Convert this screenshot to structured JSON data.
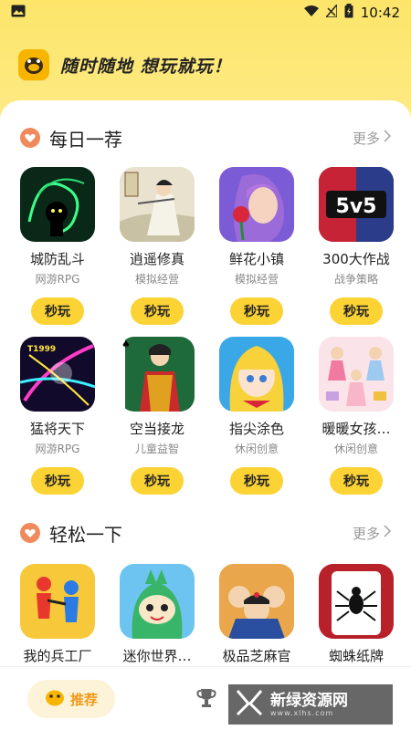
{
  "status_bar": {
    "time": "10:42"
  },
  "banner": {
    "slogan": "随时随地 想玩就玩！"
  },
  "sections": [
    {
      "title": "每日一荐",
      "more_label": "更多",
      "games": [
        {
          "name": "城防乱斗",
          "category": "网游RPG",
          "play_label": "秒玩",
          "icon": "dragon-warrior-icon"
        },
        {
          "name": "逍遥修真",
          "category": "模拟经营",
          "play_label": "秒玩",
          "icon": "cultivator-icon"
        },
        {
          "name": "鲜花小镇",
          "category": "模拟经营",
          "play_label": "秒玩",
          "icon": "flower-girl-icon"
        },
        {
          "name": "300大作战",
          "category": "战争策略",
          "play_label": "秒玩",
          "icon": "5v5-icon"
        },
        {
          "name": "猛将天下",
          "category": "网游RPG",
          "play_label": "秒玩",
          "icon": "neon-general-icon"
        },
        {
          "name": "空当接龙",
          "category": "儿童益智",
          "play_label": "秒玩",
          "icon": "playing-card-icon"
        },
        {
          "name": "指尖涂色",
          "category": "休闲创意",
          "play_label": "秒玩",
          "icon": "anime-girl-icon"
        },
        {
          "name": "暖暖女孩…",
          "category": "休闲创意",
          "play_label": "秒玩",
          "icon": "dress-up-icon"
        }
      ]
    },
    {
      "title": "轻松一下",
      "more_label": "更多",
      "games": [
        {
          "name": "我的兵工厂",
          "icon": "stickman-army-icon"
        },
        {
          "name": "迷你世界…",
          "icon": "green-monster-icon"
        },
        {
          "name": "极品芝麻官",
          "icon": "officials-icon"
        },
        {
          "name": "蜘蛛纸牌",
          "icon": "spider-card-icon"
        }
      ]
    }
  ],
  "tabbar": {
    "recommend_label": "推荐"
  },
  "watermark": {
    "text": "新绿资源网",
    "sub": "www.xlhs.com"
  },
  "colors": {
    "accent": "#fcd334",
    "banner": "#fde56a",
    "tab_active": "#f29a1a"
  }
}
